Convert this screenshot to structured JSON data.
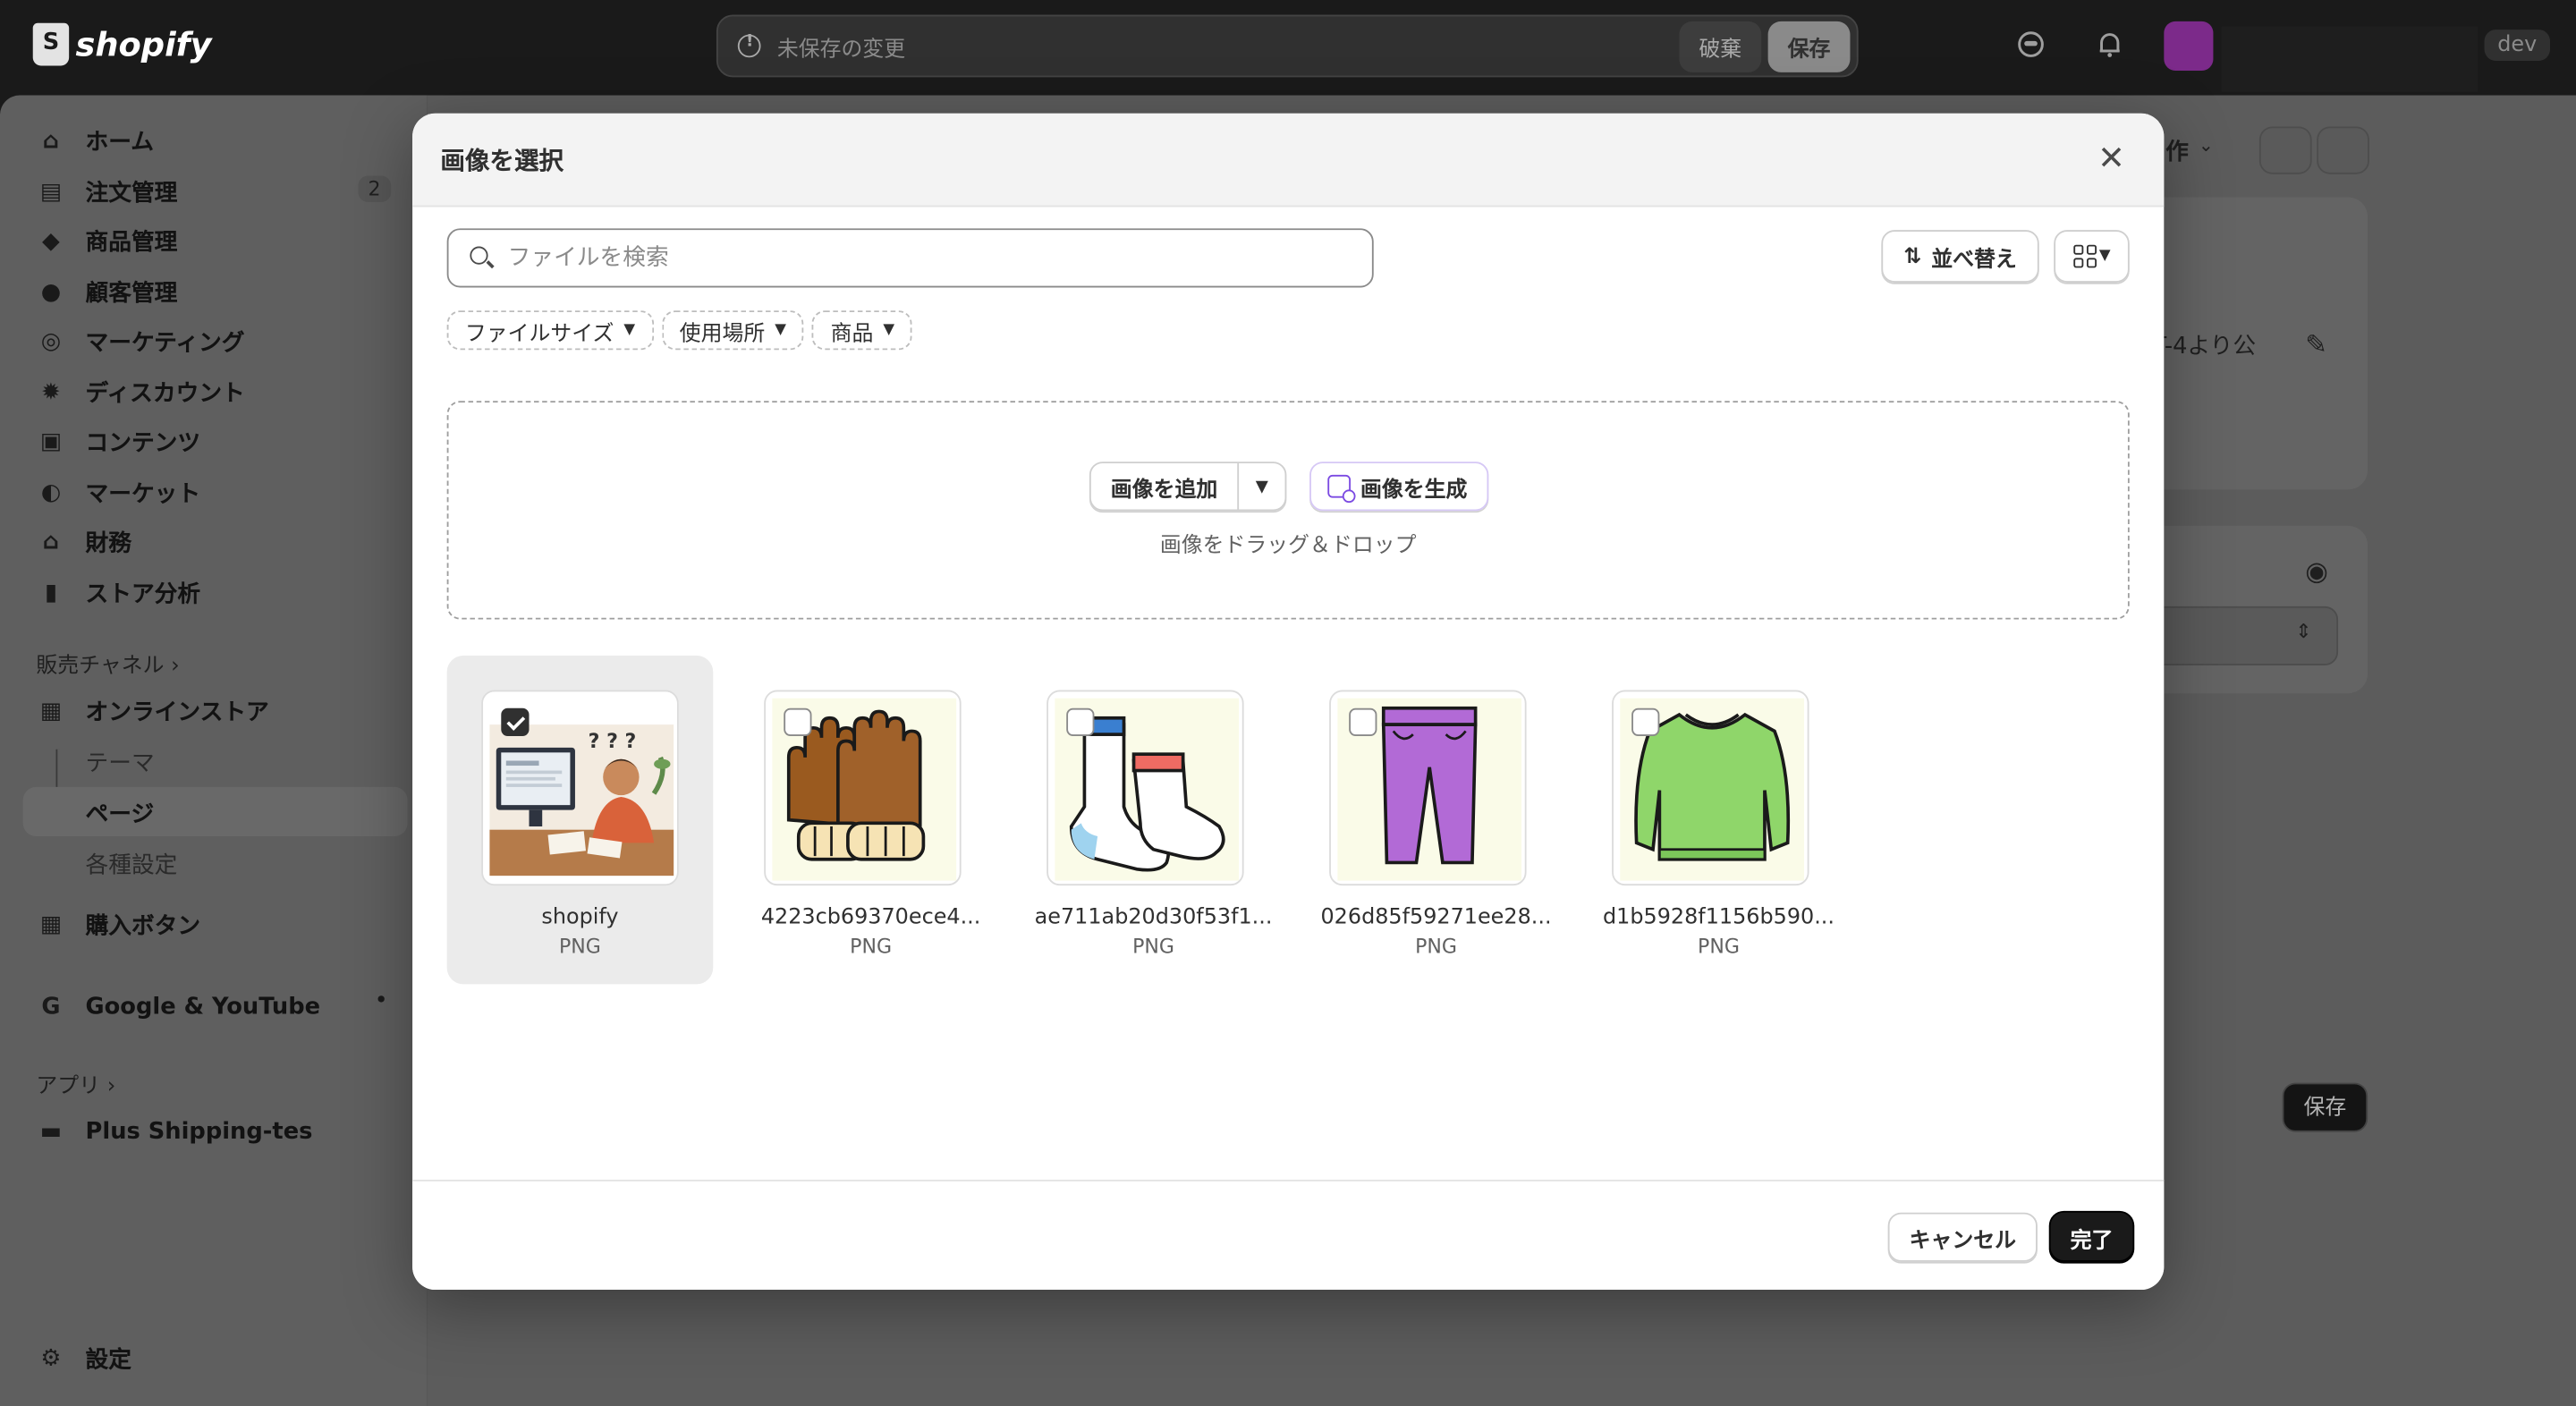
{
  "topbar": {
    "brand": "shopify",
    "unsaved_text": "未保存の変更",
    "discard_label": "破棄",
    "save_label": "保存",
    "dev_badge": "dev"
  },
  "sidebar": {
    "items": [
      {
        "label": "ホーム",
        "icon": "home-icon"
      },
      {
        "label": "注文管理",
        "icon": "inbox-icon",
        "count": "2"
      },
      {
        "label": "商品管理",
        "icon": "tag-icon"
      },
      {
        "label": "顧客管理",
        "icon": "person-icon"
      },
      {
        "label": "マーケティング",
        "icon": "target-icon"
      },
      {
        "label": "ディスカウント",
        "icon": "discount-icon"
      },
      {
        "label": "コンテンツ",
        "icon": "content-icon"
      },
      {
        "label": "マーケット",
        "icon": "globe-icon"
      },
      {
        "label": "財務",
        "icon": "bank-icon"
      },
      {
        "label": "ストア分析",
        "icon": "chart-icon"
      }
    ],
    "sales_channels_label": "販売チャネル",
    "online_store": "オンラインストア",
    "theme": "テーマ",
    "pages": "ページ",
    "preferences": "各種設定",
    "buy_button": "購入ボタン",
    "google": "Google & YouTube",
    "apps_label": "アプリ",
    "plus_shipping": "Plus Shipping-tes",
    "settings": "設定"
  },
  "background": {
    "partial_action": "作",
    "partial_text": "T-4より公",
    "save_label": "保存"
  },
  "modal": {
    "title": "画像を選択",
    "search_placeholder": "ファイルを検索",
    "sort_label": "並べ替え",
    "filters": [
      "ファイルサイズ",
      "使用場所",
      "商品"
    ],
    "add_image_label": "画像を追加",
    "generate_image_label": "画像を生成",
    "drop_text": "画像をドラッグ＆ドロップ",
    "files": [
      {
        "name": "shopify",
        "type": "PNG",
        "selected": true,
        "thumb": "person-at-computer"
      },
      {
        "name": "4223cb69370ece4...",
        "type": "PNG",
        "selected": false,
        "thumb": "gloves"
      },
      {
        "name": "ae711ab20d30f53f1...",
        "type": "PNG",
        "selected": false,
        "thumb": "socks"
      },
      {
        "name": "026d85f59271ee28...",
        "type": "PNG",
        "selected": false,
        "thumb": "pants"
      },
      {
        "name": "d1b5928f1156b590...",
        "type": "PNG",
        "selected": false,
        "thumb": "sweater"
      }
    ],
    "cancel_label": "キャンセル",
    "done_label": "完了"
  },
  "colors": {
    "accent_dark": "#1a1a1a",
    "generate_accent": "#7b4ae2",
    "avatar": "#7c2a8a"
  }
}
